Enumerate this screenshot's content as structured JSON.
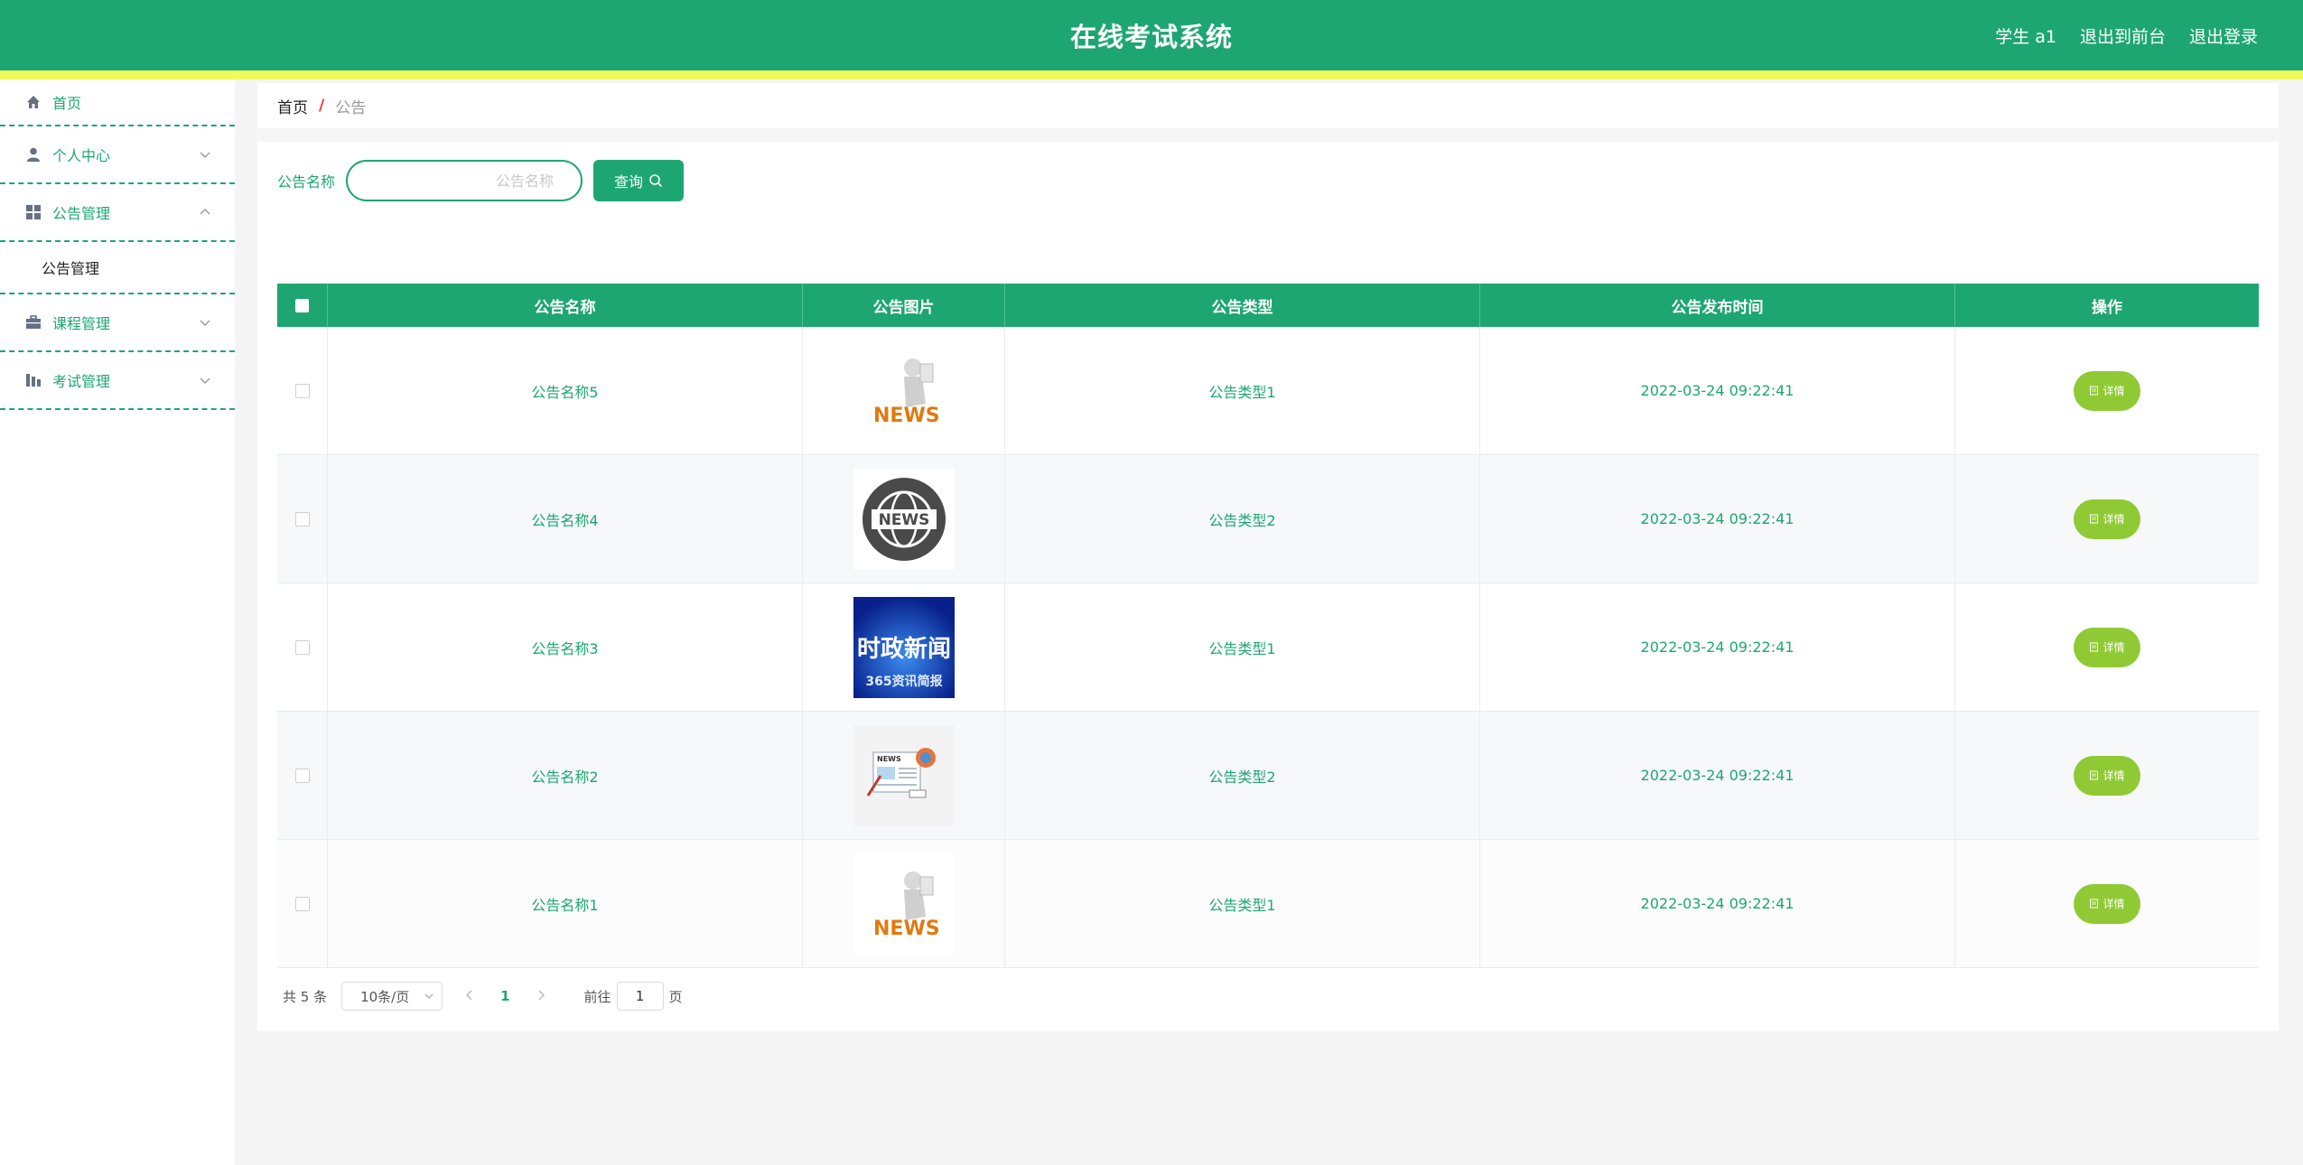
{
  "header": {
    "title": "在线考试系统",
    "user": "学生 a1",
    "to_front": "退出到前台",
    "logout": "退出登录"
  },
  "sidebar": {
    "items": [
      {
        "label": "首页",
        "icon": "home-icon"
      },
      {
        "label": "个人中心",
        "icon": "user-icon"
      },
      {
        "label": "公告管理",
        "icon": "grid-icon",
        "expanded": true,
        "children": [
          {
            "label": "公告管理"
          }
        ]
      },
      {
        "label": "课程管理",
        "icon": "briefcase-icon"
      },
      {
        "label": "考试管理",
        "icon": "chart-icon"
      }
    ]
  },
  "breadcrumb": {
    "home": "首页",
    "separator": "/",
    "current": "公告"
  },
  "search": {
    "label": "公告名称",
    "placeholder": "公告名称",
    "button": "查询"
  },
  "table": {
    "headers": [
      "公告名称",
      "公告图片",
      "公告类型",
      "公告发布时间",
      "操作"
    ],
    "rows": [
      {
        "name": "公告名称5",
        "image": "news-figure",
        "type": "公告类型1",
        "time": "2022-03-24 09:22:41",
        "action": "详情"
      },
      {
        "name": "公告名称4",
        "image": "news-globe",
        "type": "公告类型2",
        "time": "2022-03-24 09:22:41",
        "action": "详情"
      },
      {
        "name": "公告名称3",
        "image": "shizheng-xinwen",
        "type": "公告类型1",
        "time": "2022-03-24 09:22:41",
        "action": "详情"
      },
      {
        "name": "公告名称2",
        "image": "news-paper",
        "type": "公告类型2",
        "time": "2022-03-24 09:22:41",
        "action": "详情"
      },
      {
        "name": "公告名称1",
        "image": "news-figure",
        "type": "公告类型1",
        "time": "2022-03-24 09:22:41",
        "action": "详情"
      }
    ]
  },
  "pagination": {
    "total": "共 5 条",
    "page_size": "10条/页",
    "current_page": "1",
    "goto_prefix": "前往",
    "goto_value": "1",
    "goto_suffix": "页"
  },
  "thumb_text": {
    "news": "NEWS",
    "shizheng": "时政新闻",
    "shizheng_sub": "365资讯简报"
  },
  "colors": {
    "primary": "#1ea672",
    "accent_stripe": "#f0fb5b",
    "detail_button": "#8fca34"
  }
}
